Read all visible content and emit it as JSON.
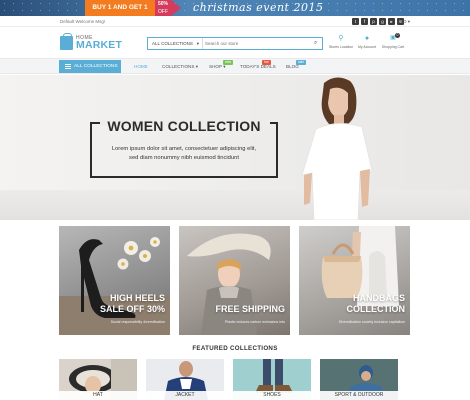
{
  "promo": {
    "deal": "BUY 1 AND GET 1 FREE",
    "percent": "50%",
    "percent_sub": "OFF",
    "event": "christmas event 2015"
  },
  "topbar": {
    "welcome": "Default Welcome Msg!",
    "currency": "USD ▾",
    "social_icons": [
      "twitter-icon",
      "facebook-icon",
      "pinterest-icon",
      "google-plus-icon",
      "youtube-icon",
      "linkedin-icon"
    ]
  },
  "header": {
    "logo_top": "HOME",
    "logo_main": "MARKET",
    "search": {
      "category": "ALL COLLECTIONS",
      "placeholder": "Search our store"
    },
    "icons": [
      {
        "name": "store-location",
        "label": "Stores Location",
        "glyph": "⚲"
      },
      {
        "name": "my-account",
        "label": "My Account",
        "glyph": "☺"
      },
      {
        "name": "shopping-cart",
        "label": "Shopping Cart",
        "glyph": "🛒"
      }
    ],
    "cart_count": "0"
  },
  "nav": {
    "all_collections": "ALL COLLECTIONS",
    "items": [
      {
        "label": "HOME",
        "active": true
      },
      {
        "label": "COLLECTIONS ▾",
        "active": false
      },
      {
        "label": "SHOP ▾",
        "active": false,
        "tag": "new"
      },
      {
        "label": "TODAY'S DEALS",
        "active": false,
        "tag": "hot"
      },
      {
        "label": "BLOG",
        "active": false,
        "tag": "sale"
      }
    ]
  },
  "hero": {
    "title": "WOMEN COLLECTION",
    "line1": "Lorem ipsum dolor sit amet, consectetuer adipiscing elit,",
    "line2": "sed diam nonummy nibh euismod tincidunt"
  },
  "tiles": [
    {
      "title1": "HIGH HEELS",
      "title2": "SALE OFF 30%",
      "sub": "Social responsibility diversification"
    },
    {
      "title1": "FREE SHIPPING",
      "title2": "",
      "sub": "Plastic reduces carbon emissions into"
    },
    {
      "title1": "HANDBAGS",
      "title2": "COLLECTION",
      "sub": "Diversification society inclusive capitalism"
    }
  ],
  "featured": {
    "title": "FEATURED COLLECTIONS",
    "items": [
      "HAT",
      "JACKET",
      "SHOES",
      "SPORT & OUTDOOR"
    ]
  },
  "colors": {
    "accent": "#5aaed6",
    "tag_new": "#7cc35a",
    "tag_hot": "#e8543f",
    "tag_sale": "#5aaed6"
  }
}
